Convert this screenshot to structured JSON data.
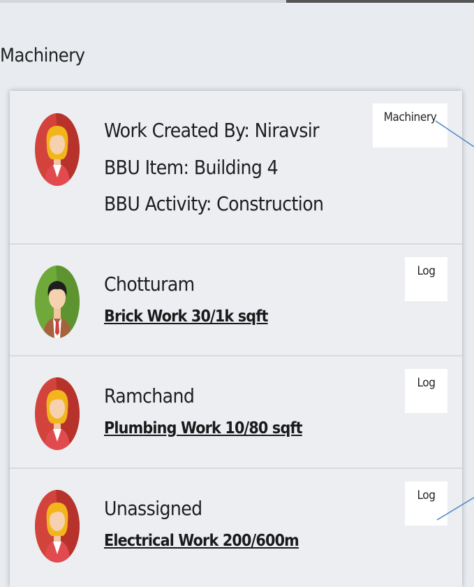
{
  "section_title": "Machinery",
  "header": {
    "created_by": "Work Created By: Niravsir",
    "bbu_item": "BBU Item: Building 4",
    "bbu_activity": "BBU Activity: Construction",
    "tag_label": "Machinery",
    "avatar": "female-user-icon"
  },
  "tasks": [
    {
      "assignee": "Chotturam",
      "work": "Brick Work 30/1k sqft",
      "log_label": "Log",
      "avatar": "male-user-icon"
    },
    {
      "assignee": "Ramchand",
      "work": "Plumbing Work 10/80 sqft",
      "log_label": "Log",
      "avatar": "female-user-icon"
    },
    {
      "assignee": "Unassigned",
      "work": "Electrical Work 200/600m",
      "log_label": "Log",
      "avatar": "female-user-icon"
    }
  ],
  "colors": {
    "background": "#e8ebef",
    "card": "#eceef2",
    "avatar_red": "#d2433b",
    "avatar_green": "#6ea93a",
    "annotation_line": "#4a86c5"
  }
}
